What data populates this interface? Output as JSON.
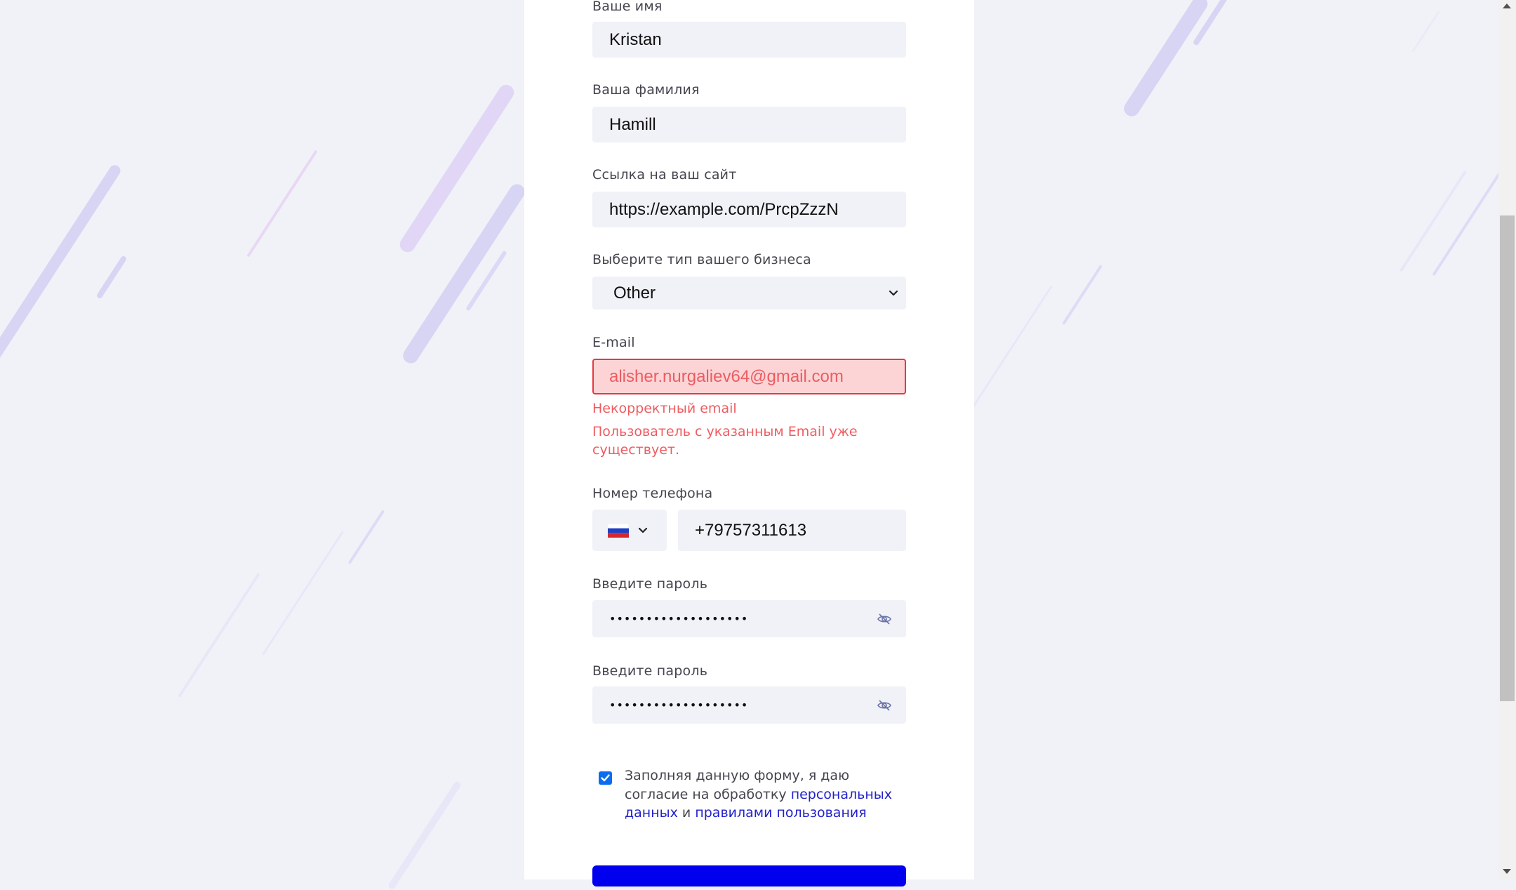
{
  "form": {
    "first_name": {
      "label": "Ваше имя",
      "value": "Kristan"
    },
    "last_name": {
      "label": "Ваша фамилия",
      "value": "Hamill"
    },
    "website": {
      "label": "Ссылка на ваш сайт",
      "value": "https://example.com/PrcpZzzN"
    },
    "business_type": {
      "label": "Выберите тип вашего бизнеса",
      "value": "Other"
    },
    "email": {
      "label": "E-mail",
      "value": "alisher.nurgaliev64@gmail.com",
      "error_invalid": "Некорректный email",
      "error_exists_line1": "Пользователь с указанным Email уже",
      "error_exists_line2": "существует."
    },
    "phone": {
      "label": "Номер телефона",
      "value": "+79757311613",
      "country": "russia-flag-icon"
    },
    "password": {
      "label": "Введите пароль",
      "value": "•••••••••••••••••••"
    },
    "password_confirm": {
      "label": "Введите пароль",
      "value": "•••••••••••••••••••"
    },
    "consent": {
      "checked": true,
      "text_line1": "Заполняя данную форму, я даю",
      "text_line2_prefix": "согласие на обработку ",
      "link_personal_1": "персональных",
      "link_personal_2": "данных",
      "and": " и ",
      "link_rules": "правилами пользования"
    }
  },
  "colors": {
    "accent": "#0000ee",
    "error": "#ee5c61",
    "error_bg": "#fcd4d6",
    "field_bg": "#f1f2f7",
    "page_bg": "#f1f2f8"
  }
}
